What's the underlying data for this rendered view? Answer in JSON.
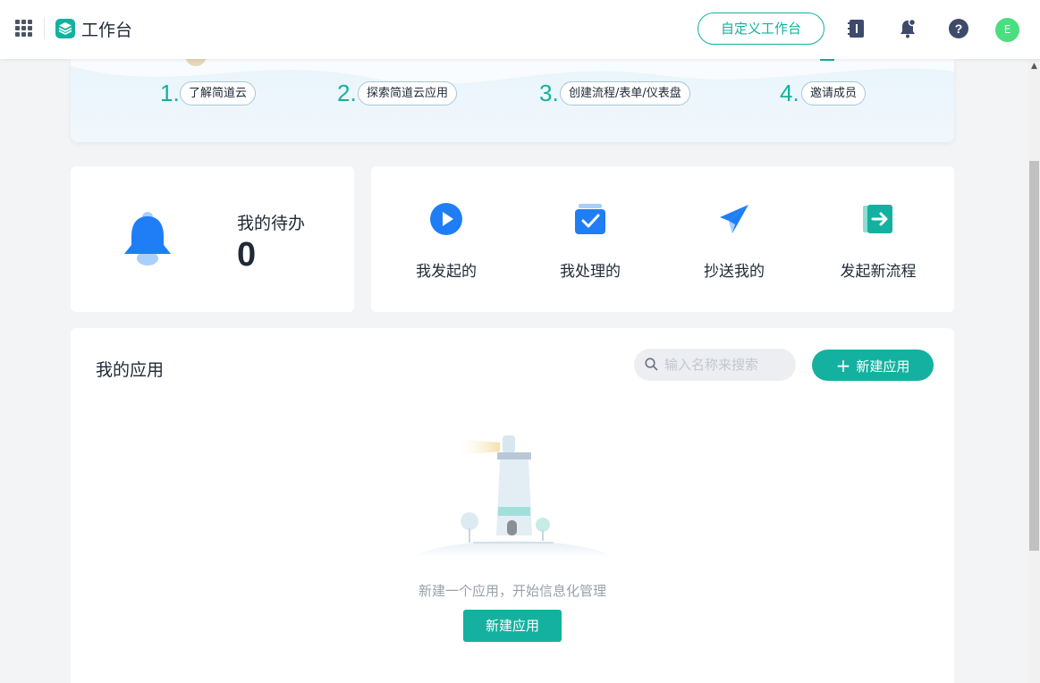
{
  "header": {
    "app_title": "工作台",
    "customize_button": "自定义工作台",
    "avatar_letter": "E",
    "brand_color": "#14b1a0"
  },
  "banner": {
    "steps": [
      {
        "num": "1.",
        "label": "了解简道云"
      },
      {
        "num": "2.",
        "label": "探索简道云应用"
      },
      {
        "num": "3.",
        "label": "创建流程/表单/仪表盘"
      },
      {
        "num": "4.",
        "label": "邀请成员"
      }
    ]
  },
  "todo": {
    "title": "我的待办",
    "count": "0"
  },
  "quick_actions": [
    {
      "label": "我发起的",
      "icon": "play-circle-icon"
    },
    {
      "label": "我处理的",
      "icon": "check-box-icon"
    },
    {
      "label": "抄送我的",
      "icon": "paper-plane-icon"
    },
    {
      "label": "发起新流程",
      "icon": "enter-door-icon"
    }
  ],
  "apps": {
    "title": "我的应用",
    "search_placeholder": "输入名称来搜索",
    "new_button": "新建应用",
    "new_button_plus": "+",
    "empty_text": "新建一个应用，开始信息化管理",
    "empty_button": "新建应用"
  }
}
